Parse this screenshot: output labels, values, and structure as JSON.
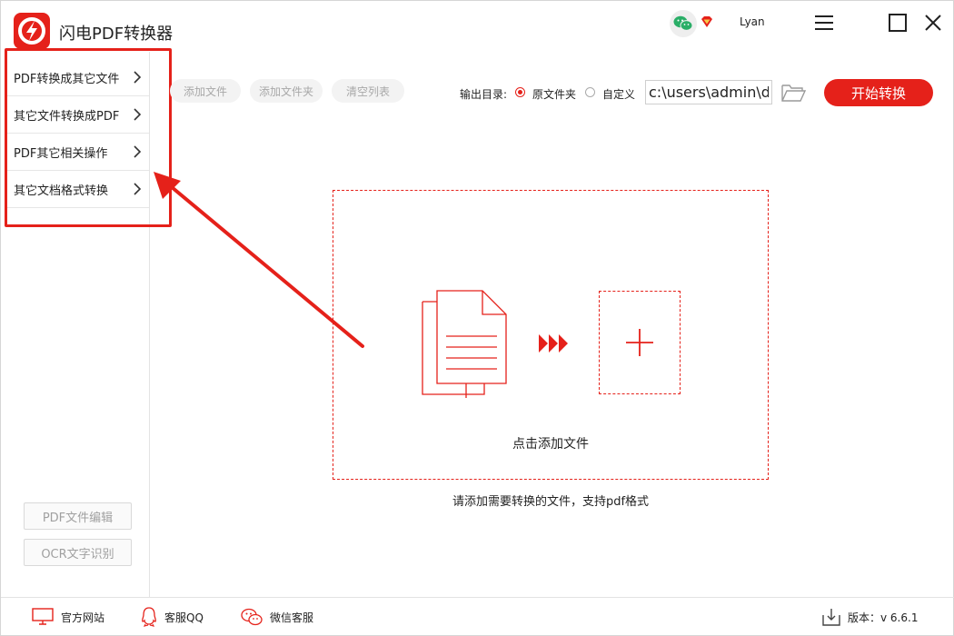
{
  "app": {
    "title": "闪电PDF转换器",
    "username": "Lyan",
    "accent_color": "#e5211a"
  },
  "sidebar": {
    "items": [
      {
        "label": "PDF转换成其它文件"
      },
      {
        "label": "其它文件转换成PDF"
      },
      {
        "label": "PDF其它相关操作"
      },
      {
        "label": "其它文档格式转换"
      }
    ],
    "tools": {
      "edit_label": "PDF文件编辑",
      "ocr_label": "OCR文字识别"
    }
  },
  "toolbar": {
    "add_file": "添加文件",
    "add_folder": "添加文件夹",
    "clear_list": "清空列表",
    "output_label": "输出目录:",
    "option_original": "原文件夹",
    "option_custom": "自定义",
    "output_path": "c:\\users\\admin\\d",
    "start_label": "开始转换"
  },
  "drop_zone": {
    "label": "点击添加文件",
    "hint": "请添加需要转换的文件，支持pdf格式"
  },
  "footer": {
    "website": "官方网站",
    "qq": "客服QQ",
    "wechat": "微信客服",
    "version": "版本：v 6.6.1"
  }
}
